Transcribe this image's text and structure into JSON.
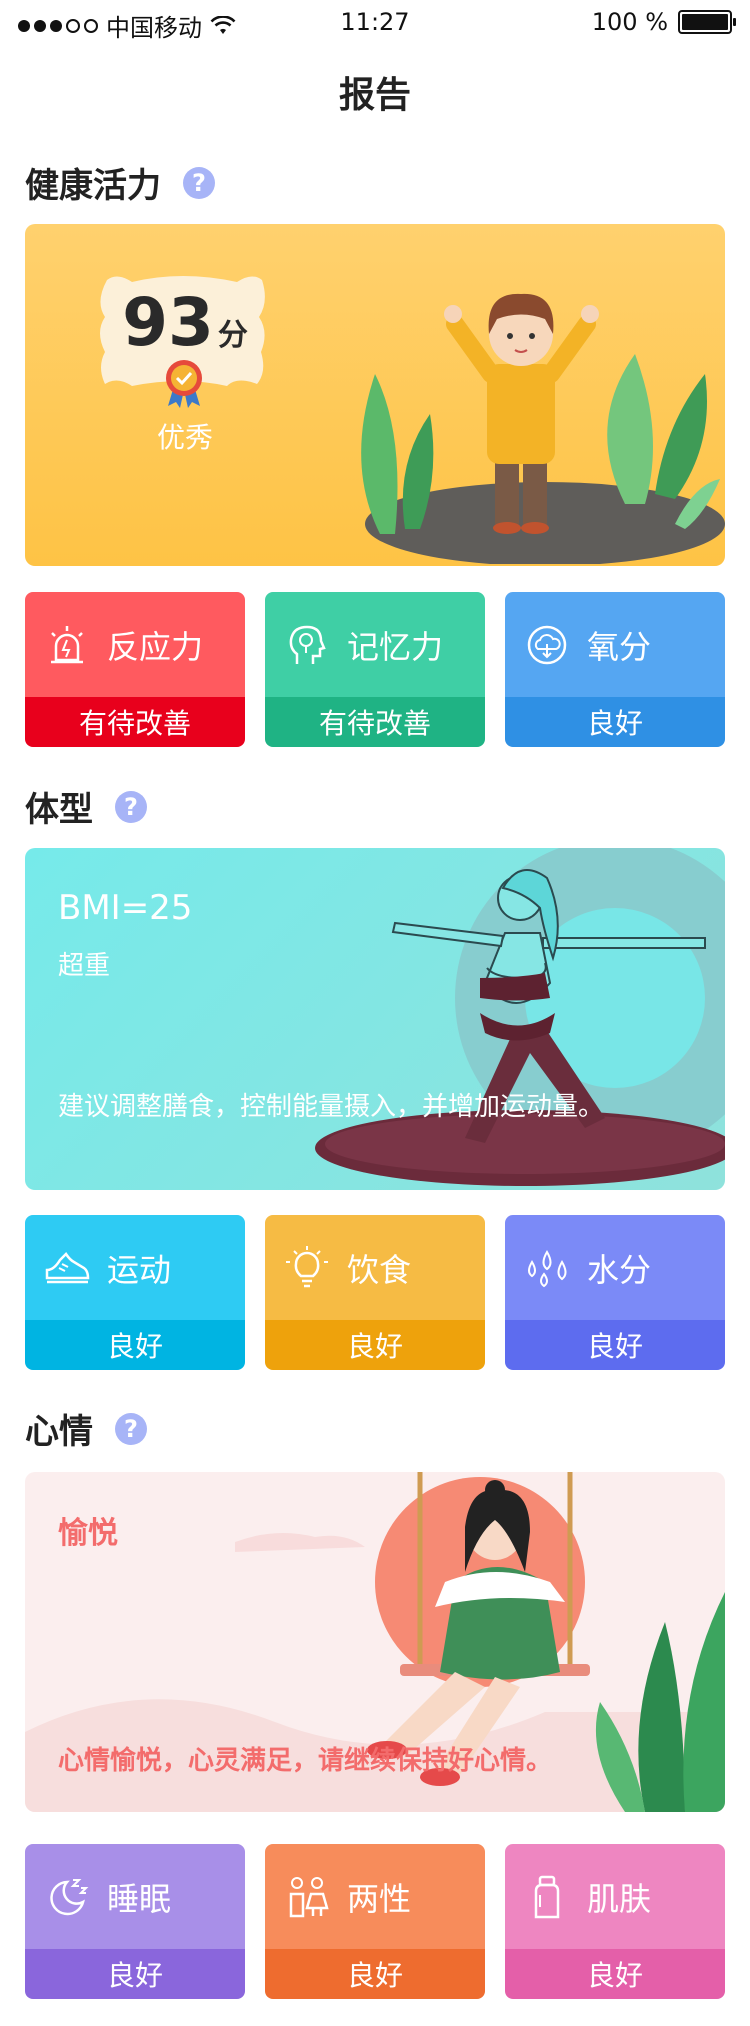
{
  "status_bar": {
    "carrier": "中国移动",
    "time": "11:27",
    "battery": "100 %"
  },
  "title": "报告",
  "sections": {
    "health": {
      "title": "健康活力",
      "help": "?"
    },
    "body": {
      "title": "体型",
      "help": "?"
    },
    "mood": {
      "title": "心情",
      "help": "?"
    }
  },
  "health_card": {
    "score": "93",
    "unit": "分",
    "level": "优秀"
  },
  "health_tiles": [
    {
      "label": "反应力",
      "status": "有待改善",
      "icon": "alarm-light-icon",
      "top_color": "#ff5a5f",
      "bottom_color": "#e8001c"
    },
    {
      "label": "记忆力",
      "status": "有待改善",
      "icon": "brain-head-icon",
      "top_color": "#3fcfa5",
      "bottom_color": "#1fb384"
    },
    {
      "label": "氧分",
      "status": "良好",
      "icon": "oxygen-cloud-icon",
      "top_color": "#55a6f2",
      "bottom_color": "#2f90e4"
    }
  ],
  "body_card": {
    "bmi": "BMI=25",
    "category": "超重",
    "advice": "建议调整膳食，控制能量摄入，并增加运动量。"
  },
  "body_tiles": [
    {
      "label": "运动",
      "status": "良好",
      "icon": "sneaker-icon",
      "top_color": "#2ecbf3",
      "bottom_color": "#00b4e2"
    },
    {
      "label": "饮食",
      "status": "良好",
      "icon": "lightbulb-icon",
      "top_color": "#f6bb44",
      "bottom_color": "#eea20c"
    },
    {
      "label": "水分",
      "status": "良好",
      "icon": "water-drops-icon",
      "top_color": "#7b8af7",
      "bottom_color": "#5d6cef"
    }
  ],
  "mood_card": {
    "mood": "愉悦",
    "advice": "心情愉悦，心灵满足，请继续保持好心情。"
  },
  "mood_tiles": [
    {
      "label": "睡眠",
      "status": "良好",
      "icon": "moon-sleep-icon",
      "top_color": "#a88fe8",
      "bottom_color": "#8a66dc"
    },
    {
      "label": "两性",
      "status": "良好",
      "icon": "gender-people-icon",
      "top_color": "#f78c5b",
      "bottom_color": "#ee6c2f"
    },
    {
      "label": "肌肤",
      "status": "良好",
      "icon": "lotion-tube-icon",
      "top_color": "#ee86c1",
      "bottom_color": "#e45fa9"
    }
  ]
}
